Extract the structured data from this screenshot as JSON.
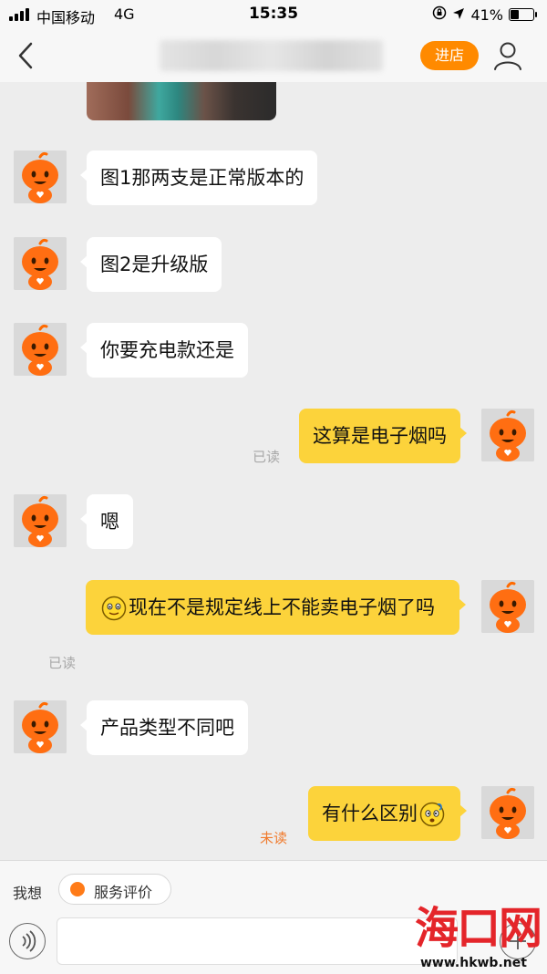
{
  "status_bar": {
    "carrier": "中国移动",
    "network": "4G",
    "time": "15:35",
    "battery_percent": "41%",
    "battery_level": 0.41
  },
  "nav": {
    "back_icon": "chevron-left-icon",
    "shop_button_label": "进店",
    "shop_button_color": "#ff8a00",
    "user_icon": "user-icon"
  },
  "messages": [
    {
      "side": "in",
      "text": "图1那两支是正常版本的"
    },
    {
      "side": "in",
      "text": "图2是升级版"
    },
    {
      "side": "in",
      "text": "你要充电款还是"
    },
    {
      "side": "out",
      "text": "这算是电子烟吗",
      "status": "已读"
    },
    {
      "side": "in",
      "text": "嗯"
    },
    {
      "side": "out",
      "text": "现在不是规定线上不能卖电子烟了吗",
      "status": "已读",
      "emoji": "awkward-smile-emoji"
    },
    {
      "side": "in",
      "text": "产品类型不同吧"
    },
    {
      "side": "out",
      "text": "有什么区别",
      "status": "未读",
      "emoji": "confused-emoji"
    }
  ],
  "bottom_bar": {
    "want_label": "我想",
    "rate_button_label": "服务评价",
    "voice_icon": "voice-icon",
    "plus_icon": "plus-icon"
  },
  "watermark": {
    "logo_text": "海口网",
    "url": "www.hkwb.net"
  },
  "colors": {
    "outgoing_bubble": "#fcd33b",
    "incoming_bubble": "#ffffff",
    "unread_status": "#f07a2c",
    "read_status": "#a8a8a8",
    "watermark_red": "#e4252a"
  }
}
